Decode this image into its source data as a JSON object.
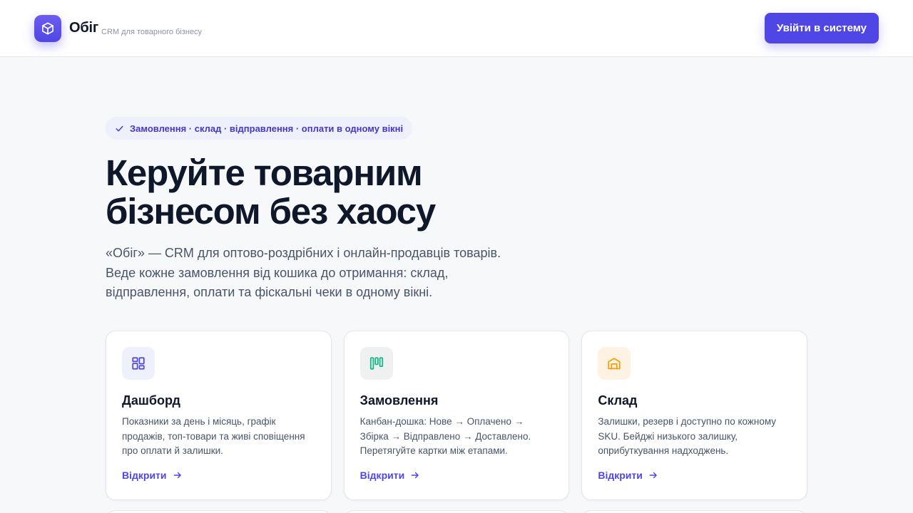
{
  "header": {
    "brand_name": "Обіг",
    "brand_tagline": "CRM для товарного бізнесу",
    "login_label": "Увійти в систему"
  },
  "hero": {
    "badge_text": "Замовлення · склад · відправлення · оплати в одному вікні",
    "title_line1": "Керуйте товарним",
    "title_line2": "бізнесом без хаосу",
    "description_line1": "«Обіг» — CRM для оптово-роздрібних і онлайн-продавців товарів.",
    "description_line2": "Веде кожне замовлення від кошика до отримання: склад,",
    "description_line3": "відправлення, оплати та фіскальні чеки в одному вікні."
  },
  "cards": [
    {
      "icon": "dashboard-icon",
      "title": "Дашборд",
      "description": "Показники за день і місяць, графік продажів, топ-товари та живі сповіщення про оплати й залишки.",
      "link": "Відкрити"
    },
    {
      "icon": "kanban-icon",
      "title": "Замовлення",
      "description": "Канбан-дошка: Нове → Оплачено → Збірка → Відправлено → Доставлено. Перетягуйте картки між етапами.",
      "link": "Відкрити"
    },
    {
      "icon": "warehouse-icon",
      "title": "Склад",
      "description": "Залишки, резерв і доступно по кожному SKU. Бейджі низького залишку, оприбуткування надходжень.",
      "link": "Відкрити"
    }
  ],
  "colors": {
    "accent": "#4f46e5",
    "accent_dark": "#4338ca",
    "kanban_green": "#10b981",
    "warehouse_amber": "#f59e0b"
  }
}
